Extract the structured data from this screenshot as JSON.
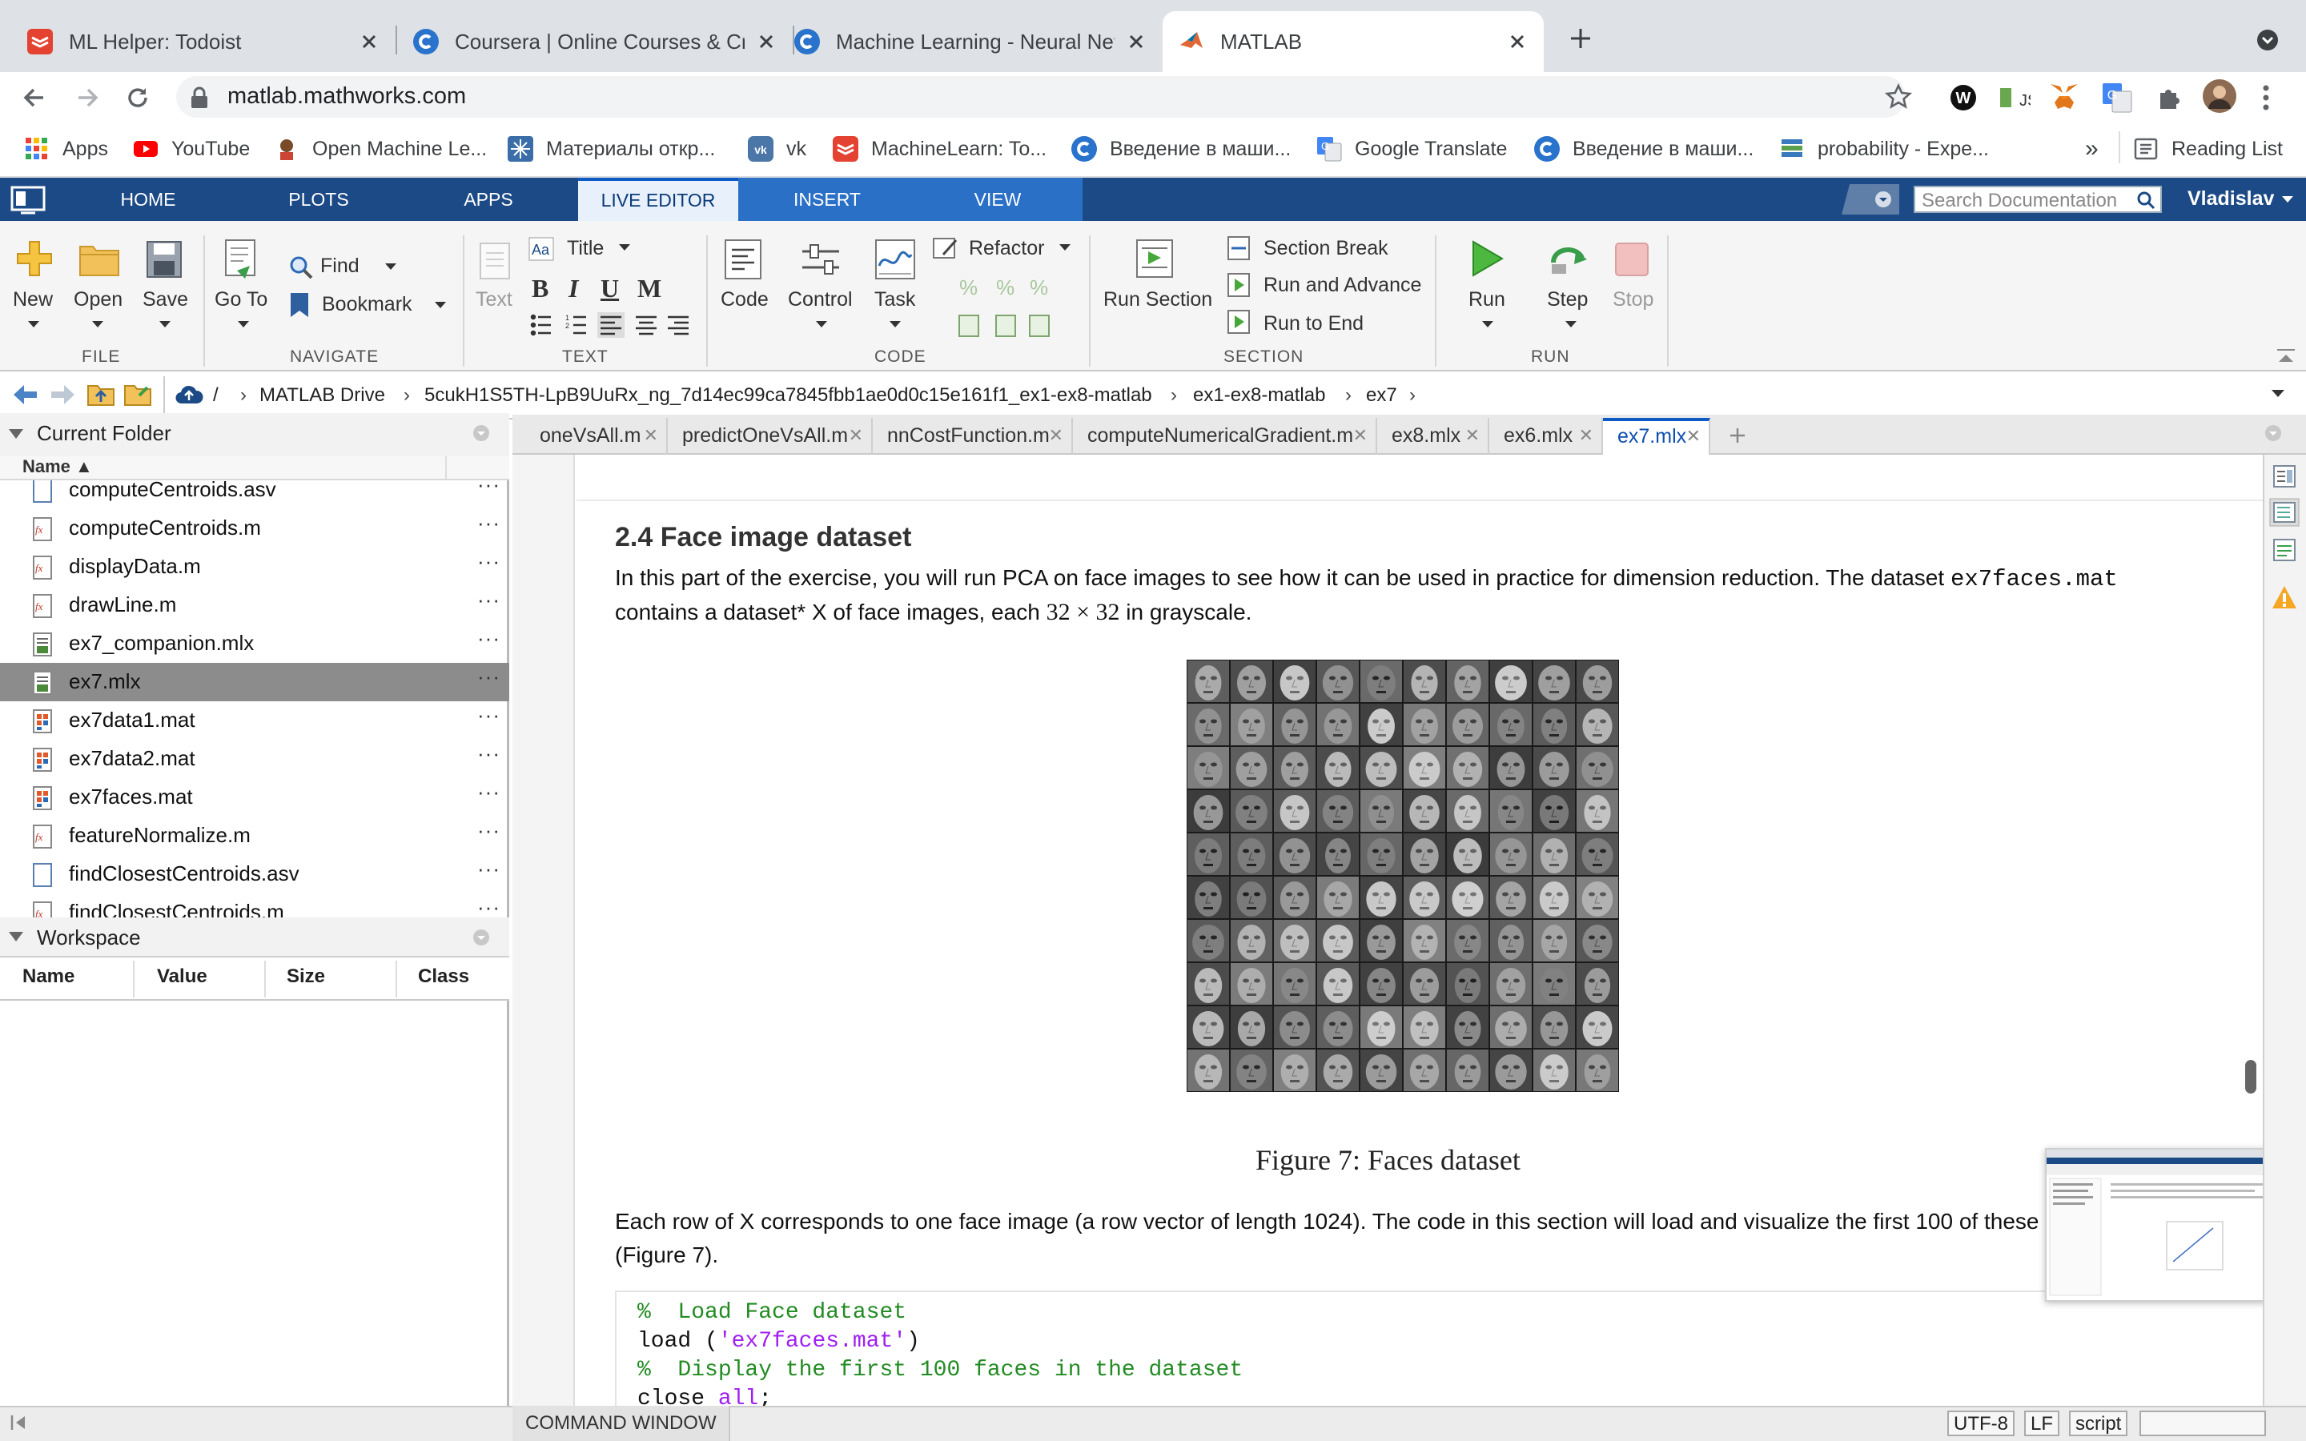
{
  "browser": {
    "tabs": [
      {
        "title": "ML Helper: Todoist",
        "icon": "todoist-icon",
        "active": false
      },
      {
        "title": "Coursera | Online Courses & Cr",
        "icon": "coursera-icon",
        "active": false
      },
      {
        "title": "Machine Learning - Neural Netw",
        "icon": "coursera-icon",
        "active": false
      },
      {
        "title": "MATLAB",
        "icon": "matlab-icon",
        "active": true
      }
    ],
    "url": "matlab.mathworks.com",
    "bookmarks": [
      {
        "label": "Apps",
        "icon": "apps-grid-icon"
      },
      {
        "label": "YouTube",
        "icon": "youtube-icon"
      },
      {
        "label": "Open Machine Le...",
        "icon": "ods-icon"
      },
      {
        "label": "Материалы откр...",
        "icon": "materials-icon"
      },
      {
        "label": "vk",
        "icon": "vk-icon"
      },
      {
        "label": "MachineLearn: To...",
        "icon": "todoist-icon"
      },
      {
        "label": "Введение в маши...",
        "icon": "coursera-icon"
      },
      {
        "label": "Google Translate",
        "icon": "google-translate-icon"
      },
      {
        "label": "Введение в маши...",
        "icon": "coursera-icon"
      },
      {
        "label": "probability - Expe...",
        "icon": "stackexchange-icon"
      }
    ],
    "bookmarks_more": "»",
    "reading_list": "Reading List"
  },
  "matlab": {
    "tabs": [
      "HOME",
      "PLOTS",
      "APPS",
      "LIVE EDITOR",
      "INSERT",
      "VIEW"
    ],
    "active_tab": "LIVE EDITOR",
    "search_placeholder": "Search Documentation",
    "user": "Vladislav",
    "ribbon": {
      "file": {
        "label": "FILE",
        "new": "New",
        "open": "Open",
        "save": "Save"
      },
      "navigate": {
        "label": "NAVIGATE",
        "goto": "Go To",
        "find": "Find",
        "bookmark": "Bookmark"
      },
      "text": {
        "label": "TEXT",
        "text_btn": "Text",
        "title": "Title",
        "bold": "B",
        "italic": "I",
        "underline": "U",
        "mono": "M"
      },
      "code": {
        "label": "CODE",
        "code": "Code",
        "control": "Control",
        "task": "Task",
        "refactor": "Refactor"
      },
      "section": {
        "label": "SECTION",
        "run_section": "Run Section",
        "section_break": "Section Break",
        "run_advance": "Run and Advance",
        "run_end": "Run to End"
      },
      "run": {
        "label": "RUN",
        "run": "Run",
        "step": "Step",
        "stop": "Stop"
      }
    },
    "breadcrumb": [
      "/",
      "MATLAB Drive",
      "5cukH1S5TH-LpB9UuRx_ng_7d14ec99ca7845fbb1ae0d0c15e161f1_ex1-ex8-matlab",
      "ex1-ex8-matlab",
      "ex7"
    ],
    "current_folder": {
      "title": "Current Folder",
      "column": "Name ▲",
      "files": [
        {
          "name": "computeCentroids.asv",
          "type": "asv"
        },
        {
          "name": "computeCentroids.m",
          "type": "m"
        },
        {
          "name": "displayData.m",
          "type": "m"
        },
        {
          "name": "drawLine.m",
          "type": "m"
        },
        {
          "name": "ex7_companion.mlx",
          "type": "mlx"
        },
        {
          "name": "ex7.mlx",
          "type": "mlx",
          "selected": true
        },
        {
          "name": "ex7data1.mat",
          "type": "mat"
        },
        {
          "name": "ex7data2.mat",
          "type": "mat"
        },
        {
          "name": "ex7faces.mat",
          "type": "mat"
        },
        {
          "name": "featureNormalize.m",
          "type": "m"
        },
        {
          "name": "findClosestCentroids.asv",
          "type": "asv"
        },
        {
          "name": "findClosestCentroids.m",
          "type": "m"
        }
      ]
    },
    "workspace": {
      "title": "Workspace",
      "columns": [
        "Name",
        "Value",
        "Size",
        "Class"
      ]
    },
    "editor_tabs": [
      "oneVsAll.m",
      "predictOneVsAll.m",
      "nnCostFunction.m",
      "computeNumericalGradient.m",
      "ex8.mlx",
      "ex6.mlx",
      "ex7.mlx"
    ],
    "active_editor_tab": "ex7.mlx",
    "document": {
      "heading": "2.4 Face image dataset",
      "p1_a": "In this part of the exercise, you will run PCA on face images to see how it can be used in practice for dimension reduction. The dataset ",
      "p1_code": "ex7faces.mat",
      "p2_a": "contains a dataset* X of face images, each ",
      "p2_math": "32 × 32",
      "p2_b": " in grayscale.",
      "figure_caption": "Figure 7:  Faces dataset",
      "p3": "Each row of X corresponds to one face image (a row vector of length 1024). The code in this section will load and visualize the first 100 of these",
      "p4": "(Figure 7).",
      "code_lines": [
        "%  Load Face dataset",
        "load ('ex7faces.mat')",
        "%  Display the first 100 faces in the dataset",
        "close all;"
      ]
    },
    "status": {
      "command_window": "COMMAND WINDOW",
      "encoding": "UTF-8",
      "line_ending": "LF",
      "mode": "script"
    }
  }
}
